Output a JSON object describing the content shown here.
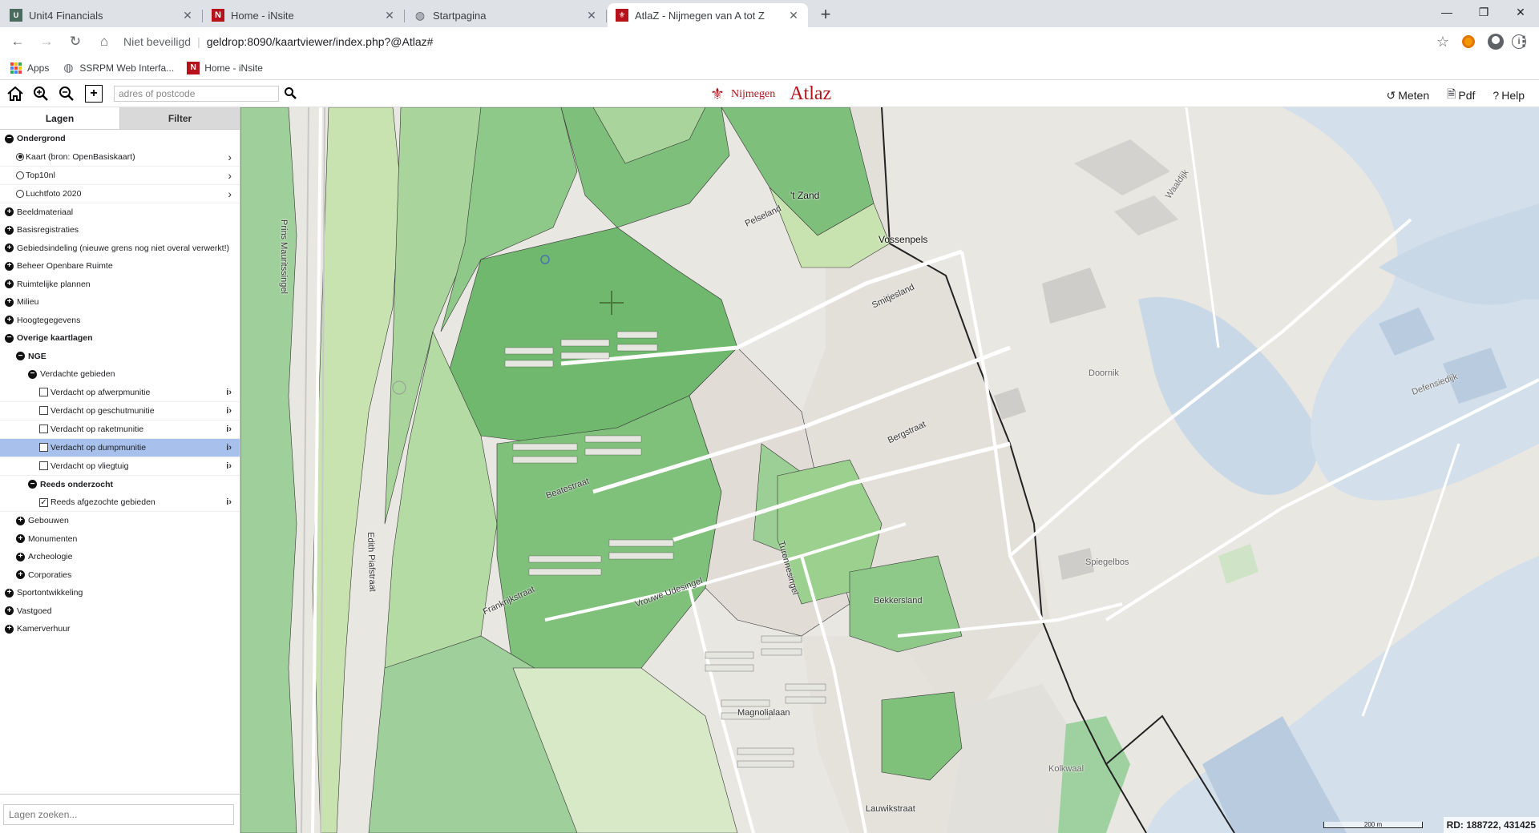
{
  "browser": {
    "tabs": [
      {
        "title": "Unit4 Financials",
        "icon": "unit4-icon"
      },
      {
        "title": "Home - iNsite",
        "icon": "insite-icon"
      },
      {
        "title": "Startpagina",
        "icon": "globe-icon"
      },
      {
        "title": "AtlaZ - Nijmegen van A tot Z",
        "icon": "atlaz-icon",
        "active": true
      }
    ],
    "security": "Niet beveiligd",
    "url": "geldrop:8090/kaartviewer/index.php?@Atlaz#",
    "bookmarks": [
      {
        "label": "Apps",
        "icon": "apps-icon"
      },
      {
        "label": "SSRPM Web Interfa...",
        "icon": "globe-icon"
      },
      {
        "label": "Home - iNsite",
        "icon": "insite-icon"
      }
    ]
  },
  "app": {
    "search_placeholder": "adres of postcode",
    "brand_city": "Nijmegen",
    "brand_app": "Atlaz",
    "actions": {
      "measure": "Meten",
      "pdf": "Pdf",
      "help": "Help"
    }
  },
  "sidebar": {
    "tab_layers": "Lagen",
    "tab_filter": "Filter",
    "tree": [
      {
        "label": "Ondergrond",
        "kind": "group-open",
        "indent": 0,
        "bold": true
      },
      {
        "label": "Kaart (bron: OpenBasiskaart)",
        "kind": "radio",
        "checked": true,
        "indent": 1,
        "chevron": true
      },
      {
        "label": "Top10nl",
        "kind": "radio",
        "checked": false,
        "indent": 1,
        "chevron": true
      },
      {
        "label": "Luchtfoto 2020",
        "kind": "radio",
        "checked": false,
        "indent": 1,
        "chevron": true
      },
      {
        "label": "Beeldmateriaal",
        "kind": "group-closed",
        "indent": 0
      },
      {
        "label": "Basisregistraties",
        "kind": "group-closed",
        "indent": 0
      },
      {
        "label": "Gebiedsindeling (nieuwe grens nog niet overal verwerkt!)",
        "kind": "group-closed",
        "indent": 0
      },
      {
        "label": "Beheer Openbare Ruimte",
        "kind": "group-closed",
        "indent": 0
      },
      {
        "label": "Ruimtelijke plannen",
        "kind": "group-closed",
        "indent": 0
      },
      {
        "label": "Milieu",
        "kind": "group-closed",
        "indent": 0
      },
      {
        "label": "Hoogtegegevens",
        "kind": "group-closed",
        "indent": 0
      },
      {
        "label": "Overige kaartlagen",
        "kind": "group-open",
        "indent": 0,
        "bold": true
      },
      {
        "label": "NGE",
        "kind": "group-open",
        "indent": 1,
        "bold": true
      },
      {
        "label": "Verdachte gebieden",
        "kind": "group-open",
        "indent": 2
      },
      {
        "label": "Verdacht op afwerpmunitie",
        "kind": "checkbox",
        "checked": false,
        "indent": 3,
        "info": true
      },
      {
        "label": "Verdacht op geschutmunitie",
        "kind": "checkbox",
        "checked": false,
        "indent": 3,
        "info": true
      },
      {
        "label": "Verdacht op raketmunitie",
        "kind": "checkbox",
        "checked": false,
        "indent": 3,
        "info": true
      },
      {
        "label": "Verdacht op dumpmunitie",
        "kind": "checkbox",
        "checked": false,
        "indent": 3,
        "info": true,
        "selected": true
      },
      {
        "label": "Verdacht op vliegtuig",
        "kind": "checkbox",
        "checked": false,
        "indent": 3,
        "info": true
      },
      {
        "label": "Reeds onderzocht",
        "kind": "group-open",
        "indent": 2,
        "bold": true
      },
      {
        "label": "Reeds afgezochte gebieden",
        "kind": "checkbox",
        "checked": true,
        "indent": 3,
        "info": true
      },
      {
        "label": "Gebouwen",
        "kind": "group-closed",
        "indent": 1
      },
      {
        "label": "Monumenten",
        "kind": "group-closed",
        "indent": 1
      },
      {
        "label": "Archeologie",
        "kind": "group-closed",
        "indent": 1
      },
      {
        "label": "Corporaties",
        "kind": "group-closed",
        "indent": 1
      },
      {
        "label": "Sportontwikkeling",
        "kind": "group-closed",
        "indent": 0
      },
      {
        "label": "Vastgoed",
        "kind": "group-closed",
        "indent": 0
      },
      {
        "label": "Kamerverhuur",
        "kind": "group-closed",
        "indent": 0
      }
    ],
    "layer_search_placeholder": "Lagen zoeken..."
  },
  "map": {
    "labels": [
      {
        "text": "Prins Mauritssingel",
        "type": "street"
      },
      {
        "text": "'t Zand",
        "type": "place"
      },
      {
        "text": "Pelseland",
        "type": "street"
      },
      {
        "text": "Vossenpels",
        "type": "place"
      },
      {
        "text": "Smitjesland",
        "type": "street"
      },
      {
        "text": "Bergstraat",
        "type": "street"
      },
      {
        "text": "Doornik",
        "type": "sub"
      },
      {
        "text": "Spiegelbos",
        "type": "sub"
      },
      {
        "text": "Bekkersland",
        "type": "street"
      },
      {
        "text": "Turennesingel",
        "type": "street"
      },
      {
        "text": "Magnolialaan",
        "type": "street"
      },
      {
        "text": "Lauwikstraat",
        "type": "street"
      },
      {
        "text": "Defensiedijk",
        "type": "sub"
      },
      {
        "text": "Waaldijk",
        "type": "sub"
      },
      {
        "text": "Frankrijkstraat",
        "type": "street"
      },
      {
        "text": "Vrouwe Udesingel",
        "type": "street"
      },
      {
        "text": "Beatestraat",
        "type": "street"
      },
      {
        "text": "Edith Piafstraat",
        "type": "street"
      },
      {
        "text": "Kolkwaal",
        "type": "sub"
      }
    ],
    "scale": "200 m",
    "coords": "RD: 188722, 431425"
  }
}
